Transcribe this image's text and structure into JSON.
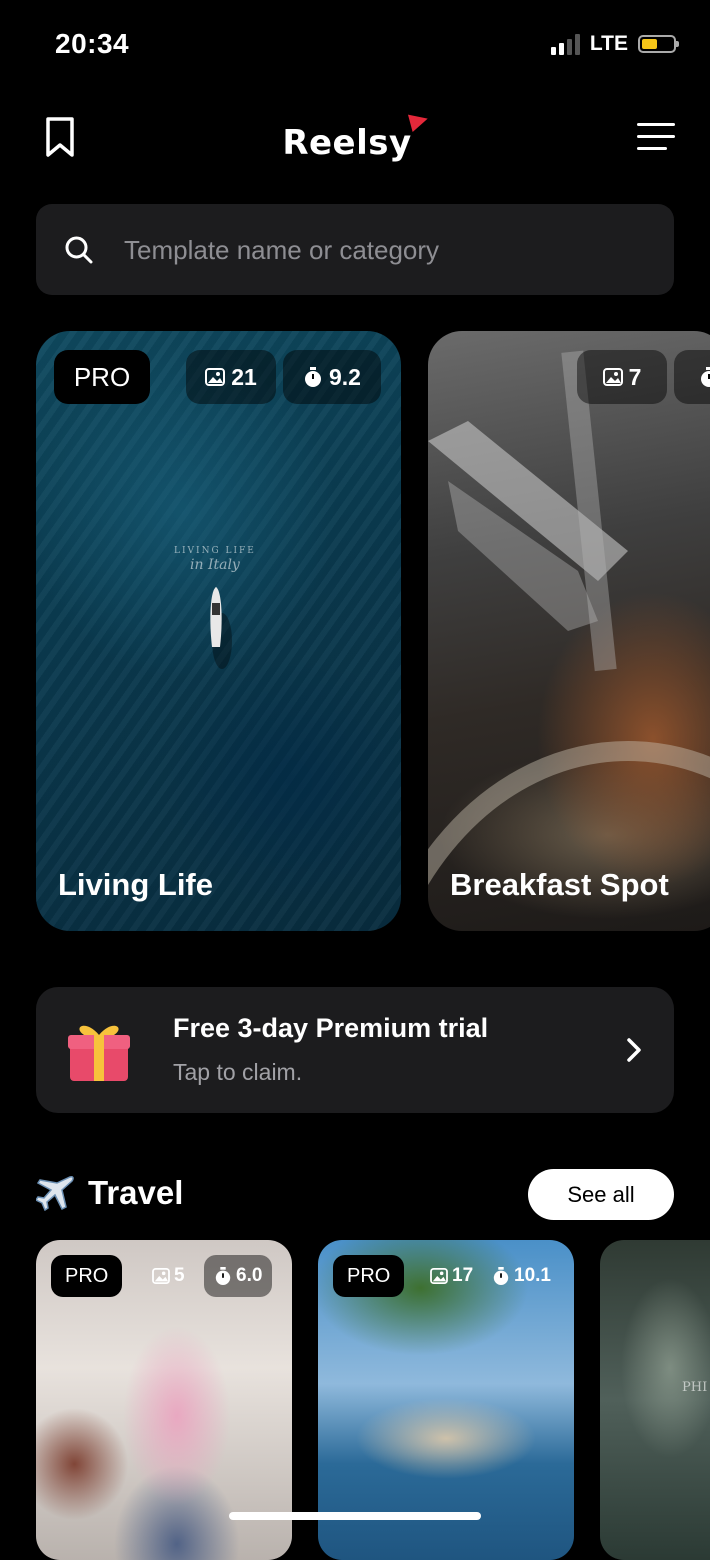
{
  "status_bar": {
    "time": "20:34",
    "network": "LTE",
    "battery_level": 0.5
  },
  "header": {
    "logo_text": "Reelsy"
  },
  "search": {
    "placeholder": "Template name or category"
  },
  "featured": [
    {
      "title": "Living Life",
      "pro": "PRO",
      "images": "21",
      "duration": "9.2",
      "overlay_line1": "LIVING LIFE",
      "overlay_line2": "in Italy"
    },
    {
      "title": "Breakfast Spot",
      "images": "7"
    }
  ],
  "promo": {
    "title": "Free 3-day Premium trial",
    "subtitle": "Tap to claim."
  },
  "travel": {
    "title": "Travel",
    "see_all": "See all",
    "cards": [
      {
        "pro": "PRO",
        "images": "5",
        "duration": "6.0"
      },
      {
        "pro": "PRO",
        "images": "17",
        "duration": "10.1"
      },
      {
        "overlay_text": "PHI"
      }
    ]
  }
}
